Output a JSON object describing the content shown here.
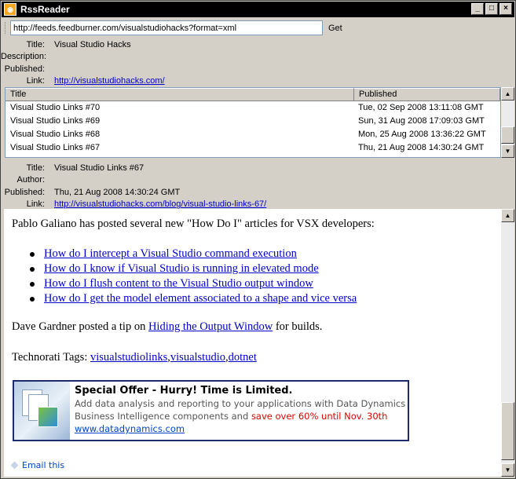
{
  "window": {
    "title": "RssReader",
    "app_icon": "rss-icon",
    "buttons": {
      "minimize": "_",
      "maximize": "□",
      "close": "×"
    }
  },
  "url_bar": {
    "value": "http://feeds.feedburner.com/visualstudiohacks?format=xml",
    "get_label": "Get"
  },
  "channel": {
    "title_label": "Title:",
    "title": "Visual Studio Hacks",
    "description_label": "Description:",
    "description": "",
    "published_label": "Published:",
    "published": "",
    "link_label": "Link:",
    "link": "http://visualstudiohacks.com/"
  },
  "list": {
    "columns": {
      "title": "Title",
      "published": "Published"
    },
    "rows": [
      {
        "title": "Visual Studio Links #70",
        "published": "Tue, 02 Sep 2008 13:11:08 GMT"
      },
      {
        "title": "Visual Studio Links #69",
        "published": "Sun, 31 Aug 2008 17:09:03 GMT"
      },
      {
        "title": "Visual Studio Links #68",
        "published": "Mon, 25 Aug 2008 13:36:22 GMT"
      },
      {
        "title": "Visual Studio Links #67",
        "published": "Thu, 21 Aug 2008 14:30:24 GMT"
      }
    ]
  },
  "item": {
    "title_label": "Title:",
    "title": "Visual Studio Links #67",
    "author_label": "Author:",
    "author": "",
    "published_label": "Published:",
    "published": "Thu, 21 Aug 2008 14:30:24 GMT",
    "link_label": "Link:",
    "link": "http://visualstudiohacks.com/blog/visual-studio-links-67/"
  },
  "content": {
    "intro": "Pablo Galiano has posted several new \"How Do I\" articles for VSX developers:",
    "links": [
      "How do I intercept a Visual Studio command execution",
      "How do I know if Visual Studio is running in elevated mode",
      "How do I flush content to the Visual Studio output window",
      "How do I get the model element associated to a shape and vice versa"
    ],
    "tip_prefix": "Dave Gardner posted a tip on ",
    "tip_link": "Hiding the Output Window",
    "tip_suffix": " for builds.",
    "tags_label": "Technorati Tags: ",
    "tags": [
      "visualstudiolinks",
      "visualstudio",
      "dotnet"
    ],
    "tag_sep": ",",
    "ad": {
      "title": "Special Offer - Hurry! Time is Limited.",
      "line1": "Add data analysis and reporting to your applications with Data Dynamics",
      "line2": "Business Intelligence components and ",
      "highlight": "save over 60% until Nov. 30th",
      "url": "www.datadynamics.com"
    },
    "email_label": "Email this"
  }
}
